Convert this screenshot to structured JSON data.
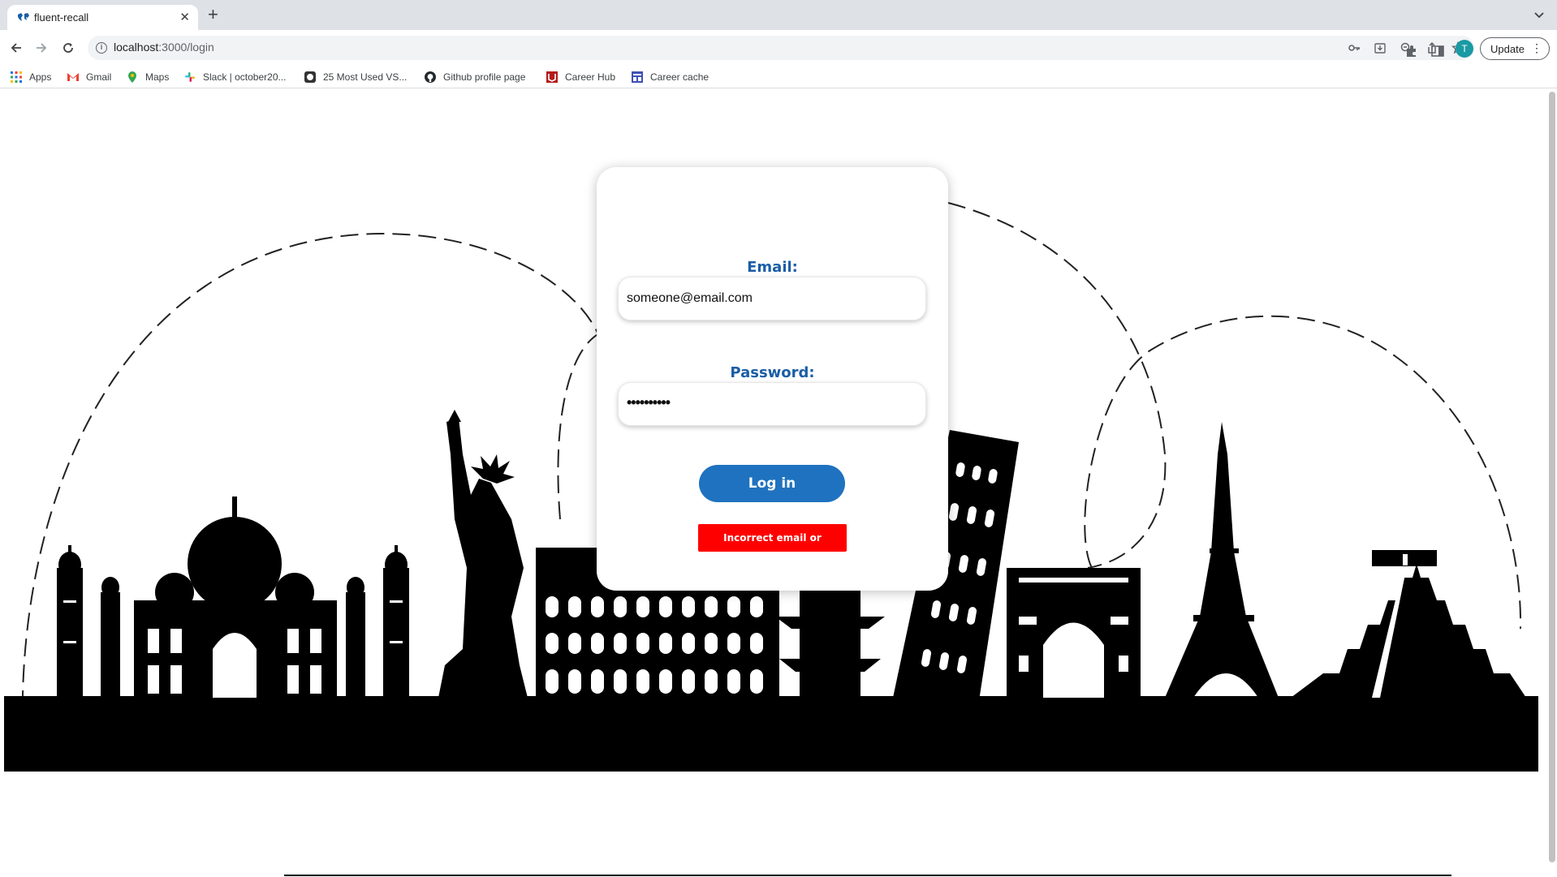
{
  "browser": {
    "tab_title": "fluent-recall",
    "url_host": "localhost",
    "url_path": ":3000/login",
    "update_label": "Update",
    "avatar_initial": "T"
  },
  "bookmarks": [
    {
      "label": "Apps",
      "icon": "apps-grid-icon"
    },
    {
      "label": "Gmail",
      "icon": "gmail-icon"
    },
    {
      "label": "Maps",
      "icon": "maps-pin-icon"
    },
    {
      "label": "Slack | october20...",
      "icon": "slack-icon"
    },
    {
      "label": "25 Most Used VS...",
      "icon": "vscode-icon"
    },
    {
      "label": "Github profile page",
      "icon": "github-icon"
    },
    {
      "label": "Career Hub",
      "icon": "career-hub-icon"
    },
    {
      "label": "Career cache",
      "icon": "career-cache-icon"
    }
  ],
  "login": {
    "email_label": "Email:",
    "email_value": "someone@email.com",
    "password_label": "Password:",
    "password_mask": "••••••••••",
    "login_button": "Log in",
    "error_message": "Incorrect email or password"
  },
  "colors": {
    "label_blue": "#1b5ea6",
    "button_blue": "#1f72bf",
    "error_red": "#ff0000"
  }
}
